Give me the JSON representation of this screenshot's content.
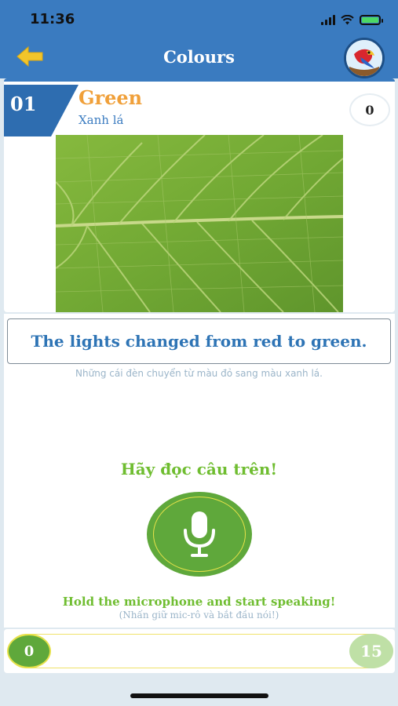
{
  "status_bar": {
    "time": "11:36"
  },
  "nav": {
    "title": "Colours",
    "back_icon": "back-arrow-icon",
    "avatar_icon": "parrot-avatar-icon"
  },
  "word": {
    "number": "01",
    "title": "Green",
    "meaning": "Xanh lá",
    "score": "0"
  },
  "sentence": {
    "text": "The lights changed from red to green.",
    "translation": "Những cái đèn chuyển từ màu đỏ sang màu xanh lá."
  },
  "speaking": {
    "prompt": "Hãy đọc câu trên!",
    "hold_instruction": "Hold the microphone and start speaking!",
    "hold_translation": "(Nhấn giữ mic-rô và bắt đầu nói!)",
    "mic_icon": "microphone-icon"
  },
  "progress": {
    "current": "0",
    "total": "15"
  },
  "colors": {
    "header": "#3a7bc0",
    "accent_orange": "#f0a03a",
    "green": "#5fa83b",
    "light_green": "#bfe0a6"
  }
}
